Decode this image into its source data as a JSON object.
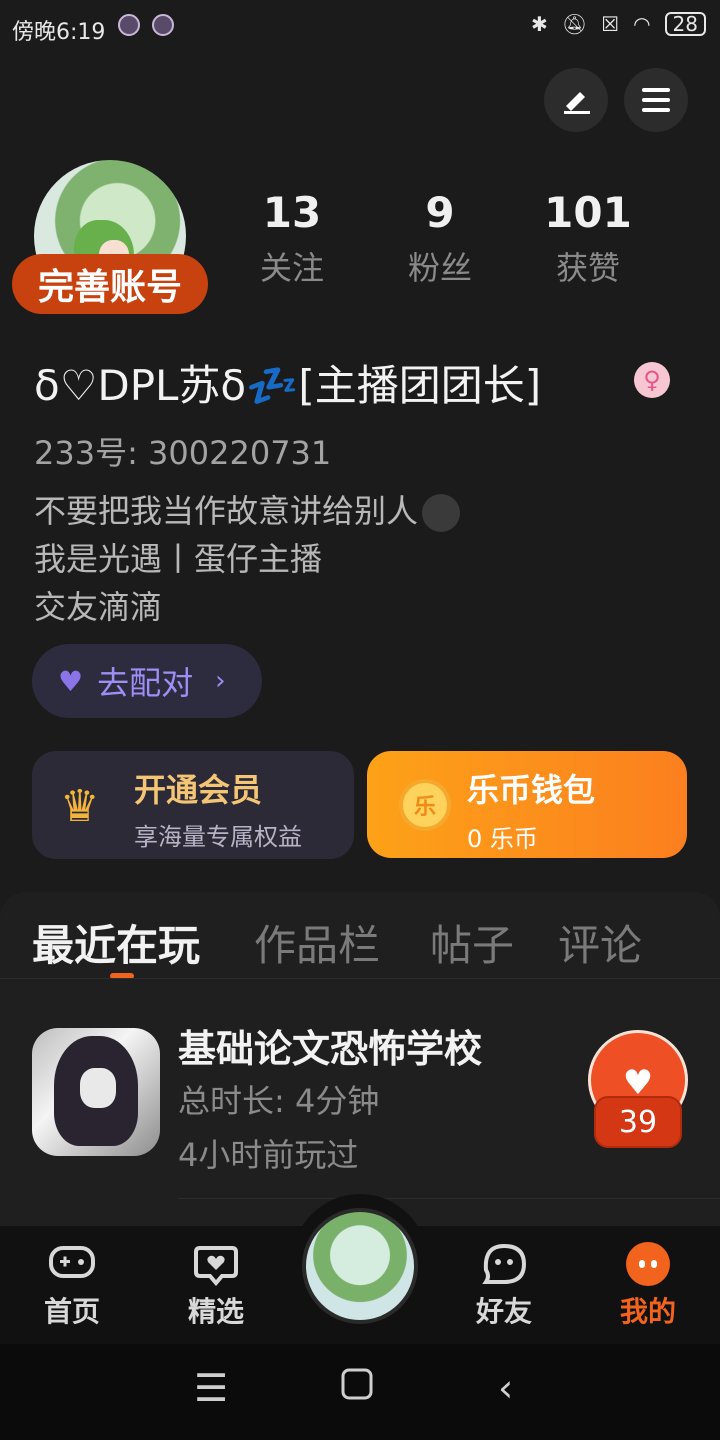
{
  "status_bar": {
    "time": "傍晚6:19",
    "battery": "28",
    "icons": [
      "bluetooth-icon",
      "mute-bell-icon",
      "sim-icon",
      "wifi-icon",
      "battery-icon"
    ]
  },
  "header": {
    "edit_icon": "pen-icon",
    "menu_icon": "menu-icon"
  },
  "profile": {
    "complete_account": "完善账号",
    "stats": [
      {
        "value": "13",
        "label": "关注"
      },
      {
        "value": "9",
        "label": "粉丝"
      },
      {
        "value": "101",
        "label": "获赞"
      }
    ],
    "username": "δ♡DPL苏δ💤[主播团团长]",
    "gender_symbol": "♀",
    "uid": "233号: 300220731",
    "bio": [
      "不要把我当作故意讲给别人",
      "我是光遇丨蛋仔主播",
      "交友滴滴"
    ],
    "match_button": "去配对"
  },
  "cards": {
    "vip_title": "开通会员",
    "vip_sub": "享海量专属权益",
    "wallet_title": "乐币钱包",
    "wallet_sub": "0 乐币",
    "coin_char": "乐"
  },
  "tabs": [
    "最近在玩",
    "作品栏",
    "帖子",
    "评论"
  ],
  "recent_game": {
    "title": "基础论文恐怖学校",
    "duration": "总时长: 4分钟",
    "last_played": "4小时前玩过",
    "likes": "39"
  },
  "bottom_nav": [
    {
      "label": "首页",
      "icon": "gamepad-icon"
    },
    {
      "label": "精选",
      "icon": "heart-chat-icon"
    },
    {
      "label": "好友",
      "icon": "friend-face-icon"
    },
    {
      "label": "我的",
      "icon": "me-icon"
    }
  ],
  "colors": {
    "accent": "#f2641d",
    "background": "#1b1b1b",
    "wallet_gradient_start": "#fda218",
    "vip_gold": "#f4c575",
    "match_purple": "#9f8ef5"
  }
}
